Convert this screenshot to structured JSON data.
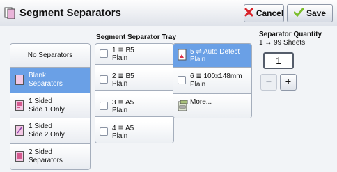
{
  "window": {
    "title": "Segment Separators"
  },
  "toolbar": {
    "cancel_label": "Cancel",
    "save_label": "Save"
  },
  "separators": {
    "items": [
      {
        "label": "No Separators",
        "selected": false,
        "icon": "none"
      },
      {
        "label": "Blank Separators",
        "line1": "Blank",
        "line2": "Separators",
        "selected": true,
        "icon": "blank-sheet-icon"
      },
      {
        "line1": "1 Sided",
        "line2": "Side 1 Only",
        "selected": false,
        "icon": "printed-sheet-icon"
      },
      {
        "line1": "1 Sided",
        "line2": "Side 2 Only",
        "selected": false,
        "icon": "printed-sheet-back-icon"
      },
      {
        "line1": "2 Sided",
        "line2": "Separators",
        "selected": false,
        "icon": "printed-sheet-duplex-icon"
      }
    ]
  },
  "tray": {
    "heading": "Segment Separator Tray",
    "left": [
      {
        "line1": "1 ≣ B5",
        "line2": "Plain"
      },
      {
        "line1": "2 ≣ B5",
        "line2": "Plain"
      },
      {
        "line1": "3 ≣ A5",
        "line2": "Plain"
      },
      {
        "line1": "4 ≣ A5",
        "line2": "Plain"
      }
    ],
    "right": [
      {
        "line1": "5 ⇌ Auto Detect",
        "line2": "Plain",
        "selected": true
      },
      {
        "line1": "6 ≣ 100x148mm",
        "line2": "Plain",
        "selected": false
      },
      {
        "line1": "More...",
        "line2": "",
        "selected": false
      }
    ]
  },
  "quantity": {
    "heading": "Separator Quantity",
    "range": "1 ↔ 99 Sheets",
    "value": "1",
    "minus_label": "−",
    "plus_label": "+"
  },
  "colors": {
    "accent": "#6aa0e6",
    "cancel_icon": "#d8232a",
    "save_icon": "#7bbd2c"
  }
}
